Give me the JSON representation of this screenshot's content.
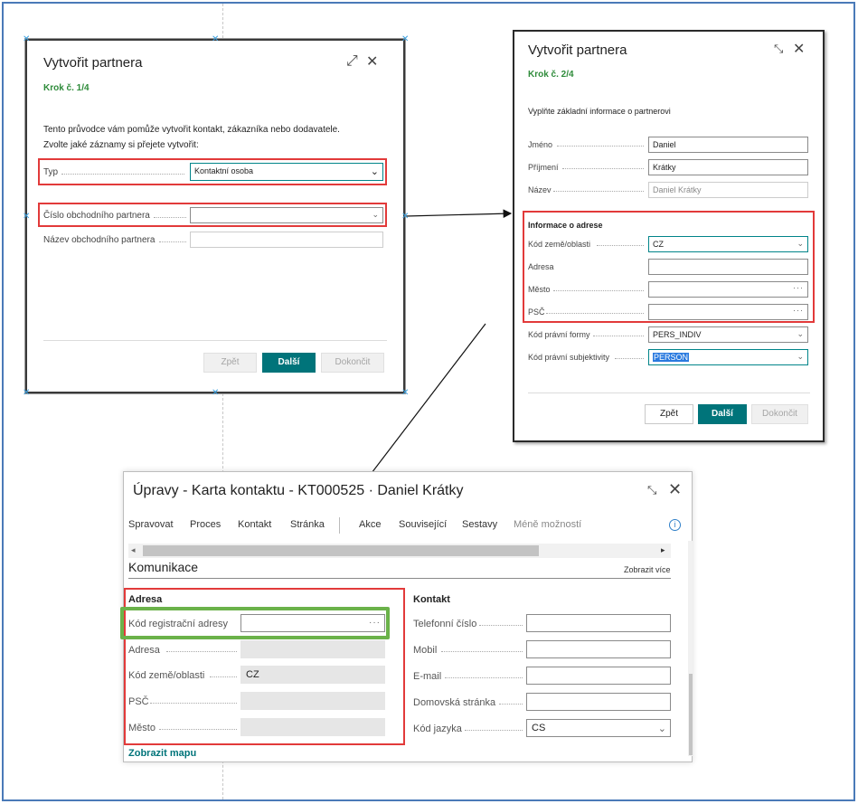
{
  "wizard_step1": {
    "title": "Vytvořit partnera",
    "step": "Krok č. 1/4",
    "intro": "Tento průvodce vám pomůže vytvořit kontakt, zákazníka nebo dodavatele.",
    "prompt": "Zvolte jaké záznamy si přejete vytvořit:",
    "type_label": "Typ",
    "type_value": "Kontaktní osoba",
    "partner_no_label": "Číslo obchodního partnera",
    "partner_no_value": "",
    "partner_name_label": "Název obchodního partnera",
    "partner_name_value": "",
    "back": "Zpět",
    "next": "Další",
    "finish": "Dokončit"
  },
  "wizard_step2": {
    "title": "Vytvořit partnera",
    "step": "Krok č. 2/4",
    "intro": "Vyplňte základní informace o partnerovi",
    "first_name_label": "Jméno",
    "first_name_value": "Daniel",
    "last_name_label": "Příjmení",
    "last_name_value": "Krátky",
    "name_label": "Název",
    "name_value": "Daniel Krátky",
    "address_section": "Informace o adrese",
    "country_label": "Kód země/oblasti",
    "country_value": "CZ",
    "address_label": "Adresa",
    "address_value": "",
    "city_label": "Město",
    "city_value": "",
    "postcode_label": "PSČ",
    "postcode_value": "",
    "legal_form_label": "Kód právní formy",
    "legal_form_value": "PERS_INDIV",
    "legal_subject_label": "Kód právní subjektivity",
    "legal_subject_value": "PERSON",
    "back": "Zpět",
    "next": "Další",
    "finish": "Dokončit"
  },
  "contact_card": {
    "title": "Úpravy - Karta kontaktu - KT000525 · Daniel Krátky",
    "menu": {
      "spravovat": "Spravovat",
      "proces": "Proces",
      "kontakt": "Kontakt",
      "stranka": "Stránka",
      "akce": "Akce",
      "souvisejici": "Související",
      "sestavy": "Sestavy",
      "mene": "Méně možností"
    },
    "section_title": "Komunikace",
    "show_more": "Zobrazit více",
    "address_group": "Adresa",
    "reg_address_label": "Kód registrační adresy",
    "reg_address_value": "",
    "address_label": "Adresa",
    "address_value": "",
    "country_label": "Kód země/oblasti",
    "country_value": "CZ",
    "postcode_label": "PSČ",
    "postcode_value": "",
    "city_label": "Město",
    "city_value": "",
    "show_map": "Zobrazit mapu",
    "contact_group": "Kontakt",
    "phone_label": "Telefonní číslo",
    "phone_value": "",
    "mobile_label": "Mobil",
    "mobile_value": "",
    "email_label": "E-mail",
    "email_value": "",
    "homepage_label": "Domovská stránka",
    "homepage_value": "",
    "language_label": "Kód jazyka",
    "language_value": "CS"
  },
  "icons": [
    "expand-icon",
    "close-icon",
    "collapse-icon",
    "chevron-down-icon",
    "ellipsis-icon",
    "info-icon"
  ],
  "colors": {
    "accent": "#00747a",
    "step_green": "#2e8b3a",
    "highlight_red": "#e23a3a",
    "highlight_green": "#6bb24a"
  }
}
